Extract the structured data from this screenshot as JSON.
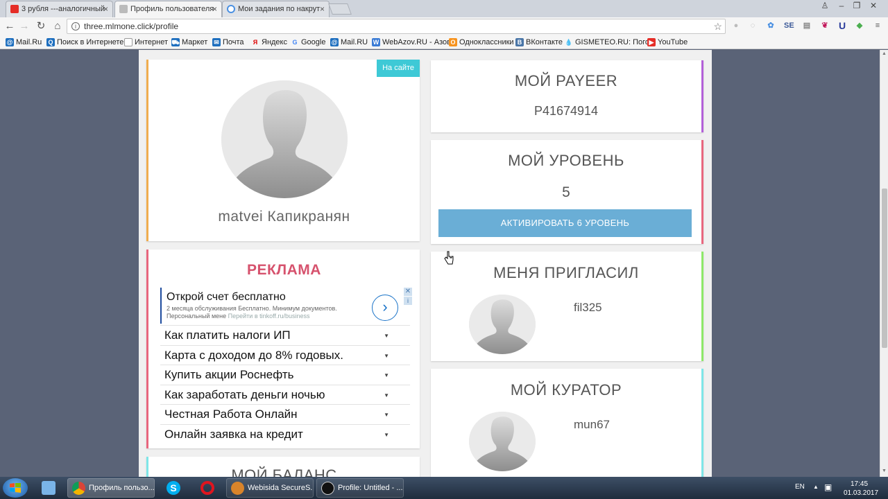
{
  "browser": {
    "tabs": [
      {
        "title": "3 рубля ---аналогичный",
        "active": false
      },
      {
        "title": "Профиль пользователя",
        "active": true
      },
      {
        "title": "Мои задания по накрут",
        "active": false
      }
    ],
    "url": "three.mlmone.click/profile",
    "bookmarks": [
      "Mail.Ru",
      "Поиск в Интернете",
      "Интернет",
      "Маркет",
      "Почта",
      "Яндекс",
      "Google",
      "Mail.RU",
      "WebAzov.RU - Азов",
      "Одноклассники",
      "ВКонтакте",
      "GISMETEO.RU: Погод",
      "YouTube"
    ]
  },
  "profile": {
    "online_badge": "На сайте",
    "username": "matvei Капикранян"
  },
  "ads": {
    "title": "РЕКЛАМА",
    "main_headline": "Открой счет бесплатно",
    "main_sub1": "2 месяца обслуживания Бесплатно. Минимум документов.",
    "main_sub2": "Персональный мене",
    "main_url": "Перейти в tinkoff.ru/business",
    "items": [
      "Как платить налоги ИП",
      "Карта с доходом до 8% годовых.",
      "Купить акции Роснефть",
      "Как заработать деньги ночью",
      "Честная Работа Онлайн",
      "Онлайн заявка на кредит"
    ]
  },
  "balance": {
    "title": "МОЙ БАЛАНС"
  },
  "payeer": {
    "title": "МОЙ PAYEER",
    "value": "P41674914"
  },
  "level": {
    "title": "МОЙ УРОВЕНЬ",
    "value": "5",
    "button": "АКТИВИРОВАТЬ 6 УРОВЕНЬ"
  },
  "inviter": {
    "title": "МЕНЯ ПРИГЛАСИЛ",
    "name": "fil325"
  },
  "curator": {
    "title": "МОЙ КУРАТОР",
    "name": "mun67"
  },
  "taskbar": {
    "items": [
      "Профиль пользо...",
      "Webisida SecureS...",
      "Profile: Untitled - ..."
    ],
    "lang": "EN",
    "time": "17:45",
    "date": "01.03.2017"
  },
  "colors": {
    "card_orange": "#f0ad4e",
    "card_red": "#e8667e",
    "card_purple": "#b25fd8",
    "card_green": "#8ee86a",
    "card_cyan": "#7ee6e8",
    "badge": "#3ec9d6",
    "button": "#6aaed6",
    "ad_title": "#d6526d"
  },
  "icons": [
    "youtube-icon",
    "page-icon",
    "chrome-icon",
    "back-icon",
    "forward-icon",
    "reload-icon",
    "home-icon",
    "info-icon",
    "star-icon",
    "chevron-right-icon",
    "close-icon",
    "dropdown-icon",
    "avatar-icon",
    "cursor-icon",
    "windows-start-icon",
    "skype-icon",
    "opera-icon"
  ]
}
